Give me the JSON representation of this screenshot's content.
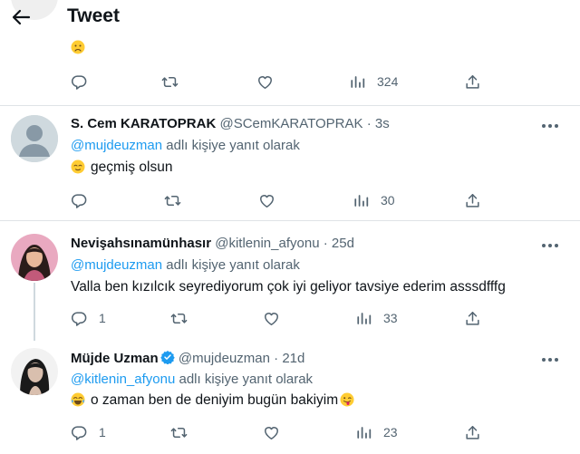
{
  "header": {
    "title": "Tweet"
  },
  "top_post": {
    "emoji": "🙁",
    "stats": {
      "views": "324"
    }
  },
  "posts": [
    {
      "name": "S. Cem KARATOPRAK",
      "handle": "@SCemKARATOPRAK",
      "dot": "·",
      "time": "3s",
      "reply_prefix": "@mujdeuzman",
      "reply_suffix": " adlı kişiye yanıt olarak",
      "text": "geçmiş olsun",
      "stats": {
        "views": "30"
      }
    },
    {
      "name": "Nevişahsınamünhasır",
      "handle": "@kitlenin_afyonu",
      "dot": "·",
      "time": "25d",
      "reply_prefix": "@mujdeuzman",
      "reply_suffix": " adlı kişiye yanıt olarak",
      "text": "Valla ben kızılcık seyrediyorum çok iyi geliyor tavsiye ederim asssdfffg",
      "stats": {
        "replies": "1",
        "views": "33"
      }
    },
    {
      "name": "Müjde Uzman",
      "handle": "@mujdeuzman",
      "dot": "·",
      "time": "21d",
      "reply_prefix": "@kitlenin_afyonu",
      "reply_suffix": " adlı kişiye yanıt olarak",
      "text": "o zaman ben de deniyim bugün bakiyim",
      "stats": {
        "replies": "1",
        "views": "23"
      }
    }
  ],
  "colors": {
    "accent": "#1d9bf0",
    "secondary_text": "#536471",
    "divider": "#dfe3e6",
    "text": "#0f1419"
  }
}
